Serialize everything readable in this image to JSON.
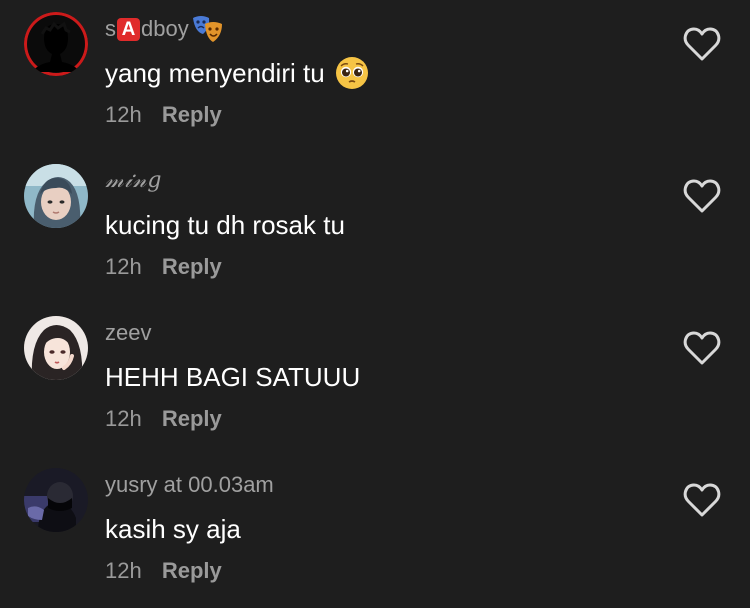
{
  "comments": [
    {
      "username_prefix": "s",
      "username_badge": "A",
      "username_suffix": "dboy",
      "username_icon": "performing-arts-masks-icon",
      "text": "yang menyendiri tu",
      "text_icon": "pleading-face-icon",
      "time": "12h",
      "reply_label": "Reply",
      "avatar": "dark-silhouette"
    },
    {
      "username": "𝓂𝒾𝓃𝑔",
      "text": "kucing tu dh rosak tu",
      "time": "12h",
      "reply_label": "Reply",
      "avatar": "photo-person-teal"
    },
    {
      "username": "zeev",
      "text": "HEHH BAGI SATUUU",
      "time": "12h",
      "reply_label": "Reply",
      "avatar": "anime-girl"
    },
    {
      "username": "yusry at 00.03am",
      "text": "kasih sy aja",
      "time": "12h",
      "reply_label": "Reply",
      "avatar": "masked-person-dark"
    }
  ],
  "like_icon": "heart-outline-icon",
  "colors": {
    "background": "#1e1e1e",
    "username": "#a0a0a0",
    "text": "#ffffff",
    "meta": "#9a9a9a",
    "badge": "#e02b2b"
  }
}
